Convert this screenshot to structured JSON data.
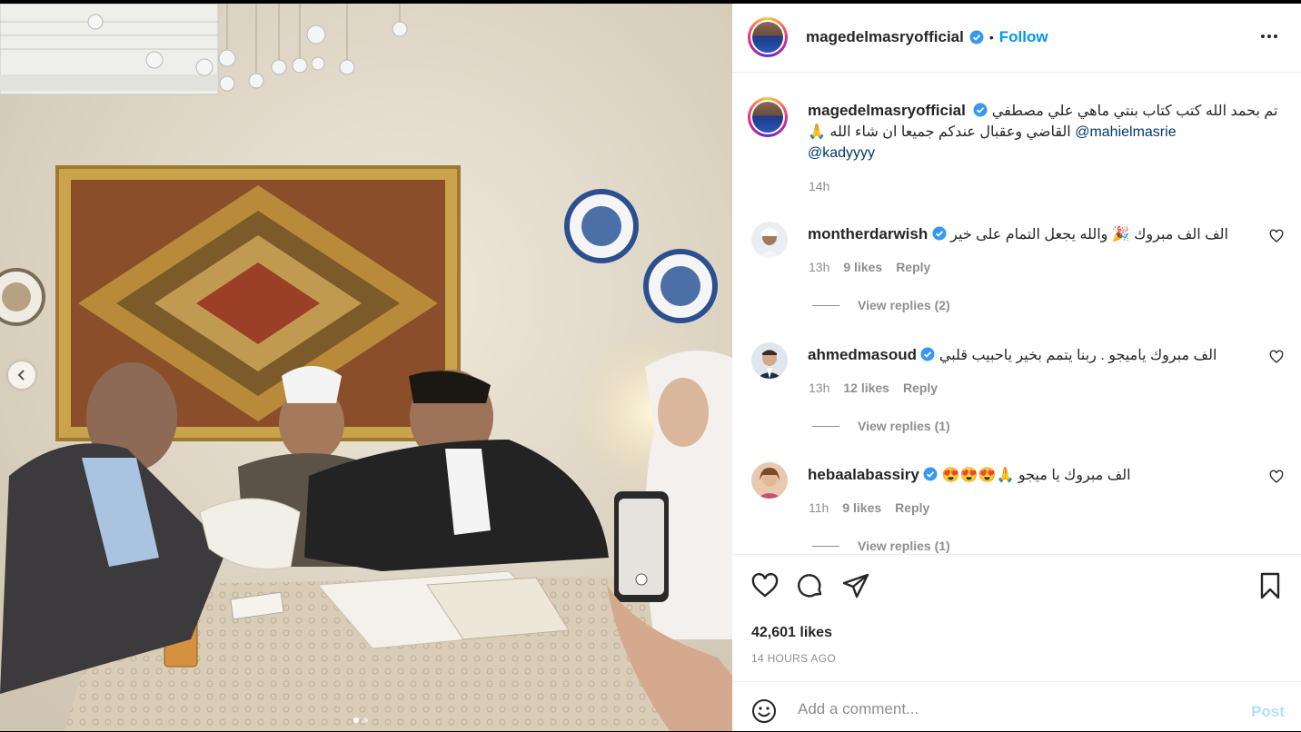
{
  "post": {
    "username": "magedelmasryofficial",
    "follow_label": "Follow",
    "bullet": "•",
    "caption_text": "تم بحمد الله كتب كتاب بنتي ماهي علي مصطفي القاضي وعقبال عندكم جميعا ان شاء الله 🙏",
    "mention_1": "@mahielmasrie",
    "mention_2": "@kadyyyy",
    "caption_time": "14h",
    "likes": "42,601 likes",
    "time_ago": "14 HOURS AGO",
    "carousel_index": 1,
    "carousel_count": 2
  },
  "comments": [
    {
      "username": "montherdarwish",
      "text": "الف الف مبروك 🎉 والله يجعل التمام على خير",
      "time": "13h",
      "likes": "9 likes",
      "reply_label": "Reply",
      "view_replies": "View replies (2)"
    },
    {
      "username": "ahmedmasoud",
      "text": "الف مبروك ياميجو . ربنا يتمم بخير ياحبيب قلبي",
      "time": "13h",
      "likes": "12 likes",
      "reply_label": "Reply",
      "view_replies": "View replies (1)"
    },
    {
      "username": "hebaalabassiry",
      "text": "الف مبروك يا ميجو 🙏😍😍😍",
      "time": "11h",
      "likes": "9 likes",
      "reply_label": "Reply",
      "view_replies": "View replies (1)"
    }
  ],
  "composer": {
    "placeholder": "Add a comment...",
    "post_label": "Post"
  },
  "icons": {
    "verified": "verified-badge-icon",
    "more": "more-options-icon",
    "like": "heart-icon",
    "comment": "comment-bubble-icon",
    "share": "paper-plane-icon",
    "save": "bookmark-icon",
    "emoji": "emoji-smiley-icon",
    "prev": "chevron-left-icon"
  },
  "colors": {
    "link": "#0095f6",
    "mention": "#00376b",
    "muted": "#8e8e8e",
    "verified": "#3897f0"
  }
}
